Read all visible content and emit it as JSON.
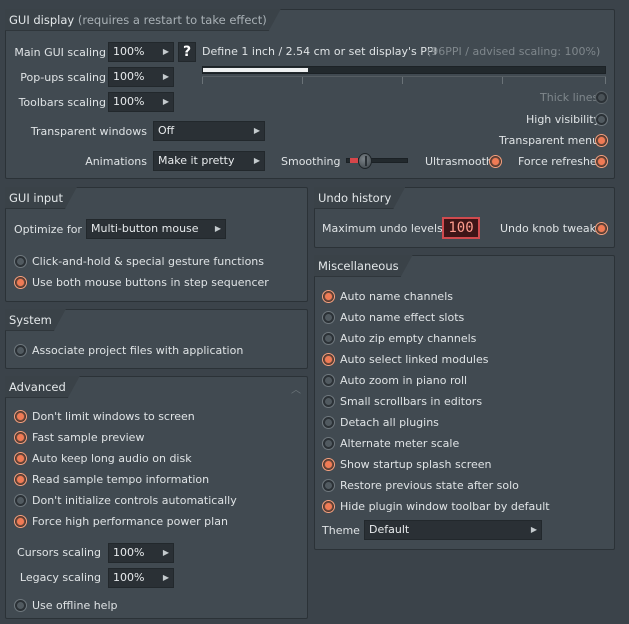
{
  "gui_display": {
    "title": "GUI display",
    "title_sub": "(requires a restart to take effect)",
    "main_scaling_label": "Main GUI scaling",
    "main_scaling_value": "100%",
    "help_label": "?",
    "ppi_text": "Define 1 inch / 2.54 cm or set display's PPI",
    "ppi_info": "(96PPI / advised scaling: 100%)",
    "ppi_slider_fraction": 0.26,
    "popups_label": "Pop-ups scaling",
    "popups_value": "100%",
    "toolbars_label": "Toolbars scaling",
    "toolbars_value": "100%",
    "transparent_label": "Transparent windows",
    "transparent_value": "Off",
    "animations_label": "Animations",
    "animations_value": "Make it pretty",
    "smoothing_label": "Smoothing",
    "smoothing_fraction": 0.25,
    "thick_lines_label": "Thick lines",
    "high_visibility_label": "High visibility",
    "transparent_menus_label": "Transparent menus",
    "ultrasmooth_label": "Ultrasmooth",
    "force_refreshes_label": "Force refreshes"
  },
  "gui_input": {
    "title": "GUI input",
    "optimize_label": "Optimize for",
    "optimize_value": "Multi-button mouse",
    "options": [
      {
        "label": "Click-and-hold & special gesture functions",
        "on": false
      },
      {
        "label": "Use both mouse buttons in step sequencer",
        "on": true
      }
    ]
  },
  "system": {
    "title": "System",
    "options": [
      {
        "label": "Associate project files with application",
        "on": false
      }
    ]
  },
  "advanced": {
    "title": "Advanced",
    "options": [
      {
        "label": "Don't limit windows to screen",
        "on": true
      },
      {
        "label": "Fast sample preview",
        "on": true
      },
      {
        "label": "Auto keep long audio on disk",
        "on": true
      },
      {
        "label": "Read sample tempo information",
        "on": true
      },
      {
        "label": "Don't initialize controls automatically",
        "on": false
      },
      {
        "label": "Force high performance power plan",
        "on": true
      }
    ],
    "cursors_label": "Cursors scaling",
    "cursors_value": "100%",
    "legacy_label": "Legacy scaling",
    "legacy_value": "100%",
    "offline_help_label": "Use offline help"
  },
  "undo_history": {
    "title": "Undo history",
    "max_levels_label": "Maximum undo levels",
    "max_levels_value": "100",
    "knob_tweaks_label": "Undo knob tweaks"
  },
  "misc": {
    "title": "Miscellaneous",
    "options": [
      {
        "label": "Auto name channels",
        "on": true
      },
      {
        "label": "Auto name effect slots",
        "on": false
      },
      {
        "label": "Auto zip empty channels",
        "on": false
      },
      {
        "label": "Auto select linked modules",
        "on": true
      },
      {
        "label": "Auto zoom in piano roll",
        "on": false
      },
      {
        "label": "Small scrollbars in editors",
        "on": false
      },
      {
        "label": "Detach all plugins",
        "on": false
      },
      {
        "label": "Alternate meter scale",
        "on": false
      },
      {
        "label": "Show startup splash screen",
        "on": true
      },
      {
        "label": "Restore previous state after solo",
        "on": false
      },
      {
        "label": "Hide plugin window toolbar by default",
        "on": true
      }
    ],
    "theme_label": "Theme",
    "theme_value": "Default"
  },
  "colors": {
    "accent_on": "#f07b55",
    "undo_border": "#d04a4e"
  }
}
